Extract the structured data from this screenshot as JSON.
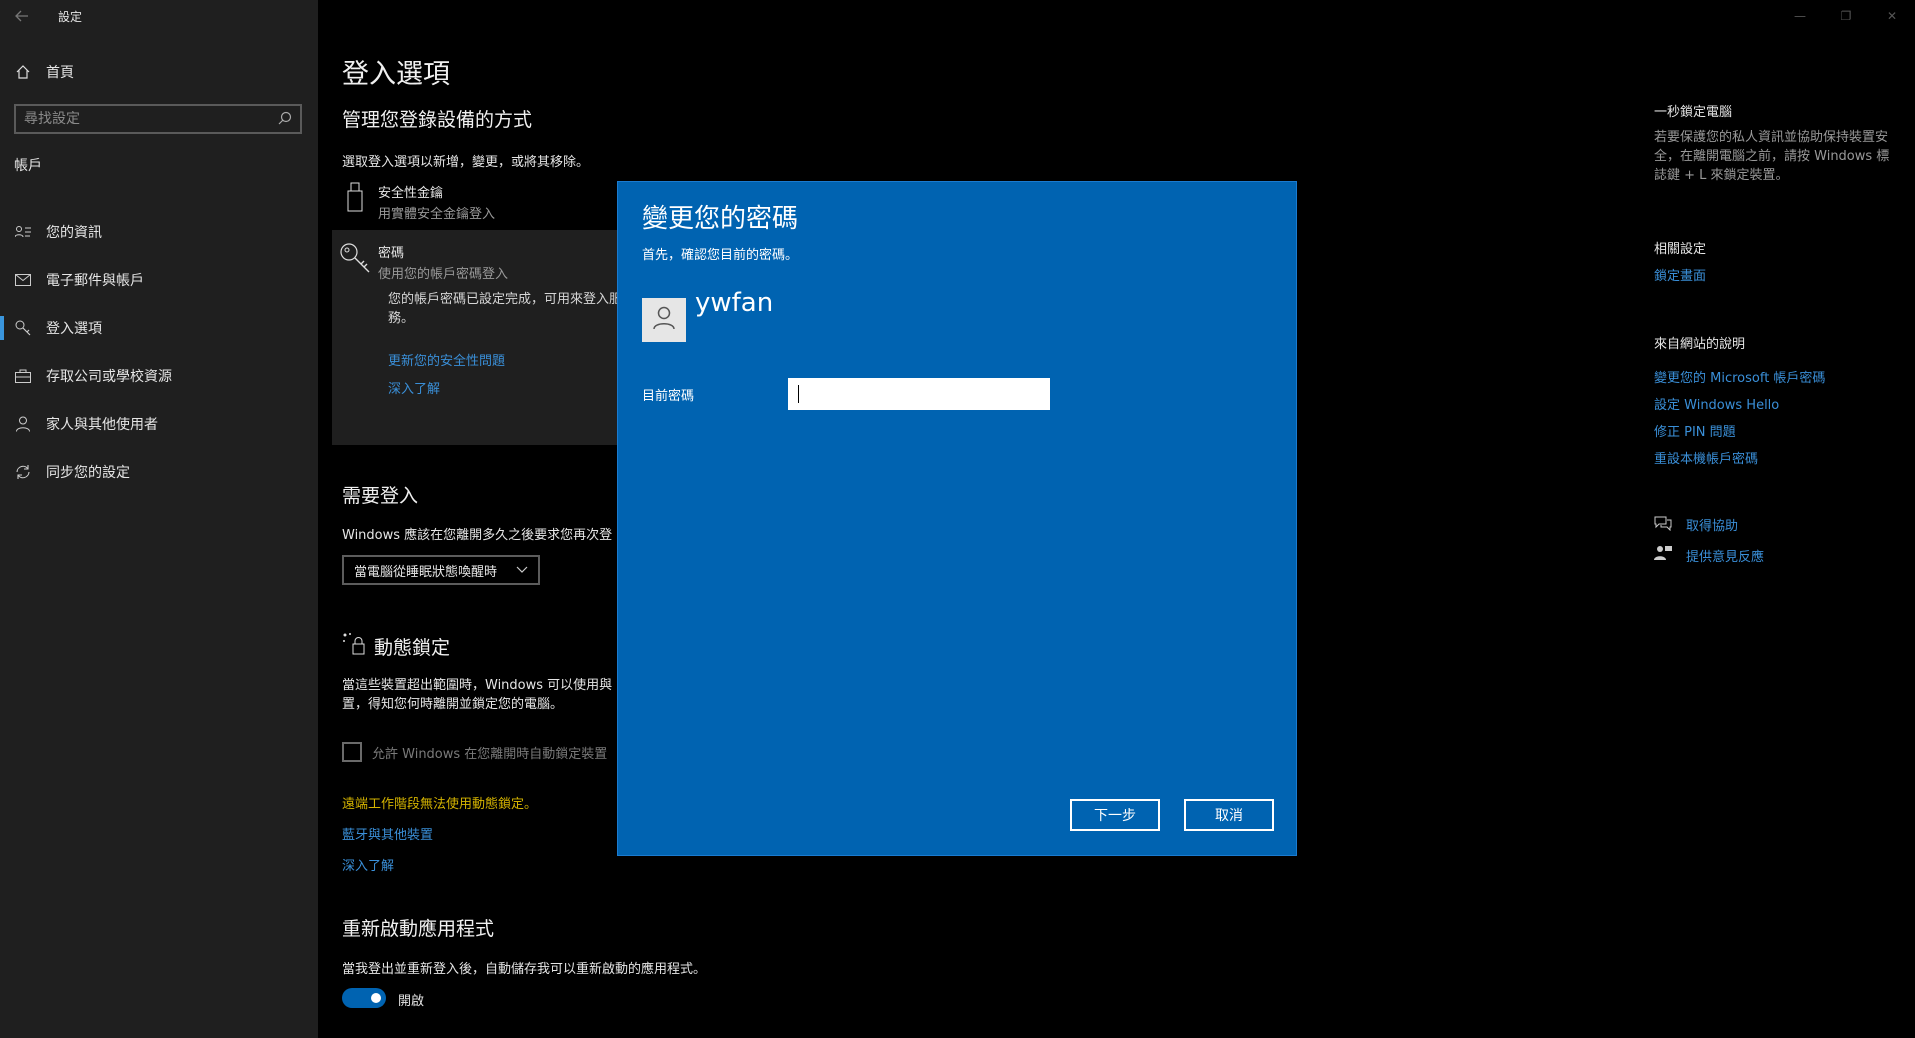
{
  "app": {
    "title": "設定",
    "back_icon": "back-arrow-icon"
  },
  "sidebar": {
    "home_label": "首頁",
    "search_placeholder": "尋找設定",
    "section_title": "帳戶",
    "items": [
      {
        "label": "您的資訊",
        "icon": "person-info-icon"
      },
      {
        "label": "電子郵件與帳戶",
        "icon": "mail-icon"
      },
      {
        "label": "登入選項",
        "icon": "key-icon",
        "active": true
      },
      {
        "label": "存取公司或學校資源",
        "icon": "briefcase-icon"
      },
      {
        "label": "家人與其他使用者",
        "icon": "person-icon"
      },
      {
        "label": "同步您的設定",
        "icon": "sync-icon"
      }
    ]
  },
  "main": {
    "title": "登入選項",
    "subtitle": "管理您登錄設備的方式",
    "desc": "選取登入選項以新增，變更，或將其移除。",
    "options": [
      {
        "title": "安全性金鑰",
        "sub": "用實體安全金鑰登入"
      },
      {
        "title": "密碼",
        "sub": "使用您的帳戶密碼登入"
      }
    ],
    "password_para": "您的帳戶密碼已設定完成，可用來登入服務。",
    "password_links": [
      "更新您的安全性問題",
      "深入了解"
    ],
    "require_heading": "需要登入",
    "require_text": "Windows 應該在您離開多久之後要求您再次登",
    "require_dropdown": "當電腦從睡眠狀態喚醒時",
    "dynamic_heading": "動態鎖定",
    "dynamic_text": "當這些裝置超出範圍時，Windows 可以使用與置，得知您何時離開並鎖定您的電腦。",
    "dynamic_checkbox": "允許 Windows 在您離開時自動鎖定裝置",
    "dynamic_warning": "遠端工作階段無法使用動態鎖定。",
    "dynamic_links": [
      "藍牙與其他裝置",
      "深入了解"
    ],
    "restart_heading": "重新啟動應用程式",
    "restart_text": "當我登出並重新登入後，自動儲存我可以重新啟動的應用程式。",
    "restart_toggle": "開啟"
  },
  "right": {
    "lock_heading": "一秒鎖定電腦",
    "lock_text": "若要保護您的私人資訊並協助保持裝置安全，在離開電腦之前，請按 Windows 標誌鍵 + L 來鎖定裝置。",
    "related_heading": "相關設定",
    "related_link": "鎖定畫面",
    "web_heading": "來自網站的說明",
    "web_links": [
      "變更您的 Microsoft 帳戶密碼",
      "設定 Windows Hello",
      "修正 PIN 問題",
      "重設本機帳戶密碼"
    ],
    "help_link": "取得協助",
    "feedback_link": "提供意見反應"
  },
  "dialog": {
    "title": "變更您的密碼",
    "subtitle": "首先，確認您目前的密碼。",
    "username": "ywfan",
    "field_label": "目前密碼",
    "field_value": "",
    "next_label": "下一步",
    "cancel_label": "取消"
  },
  "colors": {
    "accent": "#0063b1",
    "link": "#3a8fd8",
    "warning": "#d4b300"
  }
}
